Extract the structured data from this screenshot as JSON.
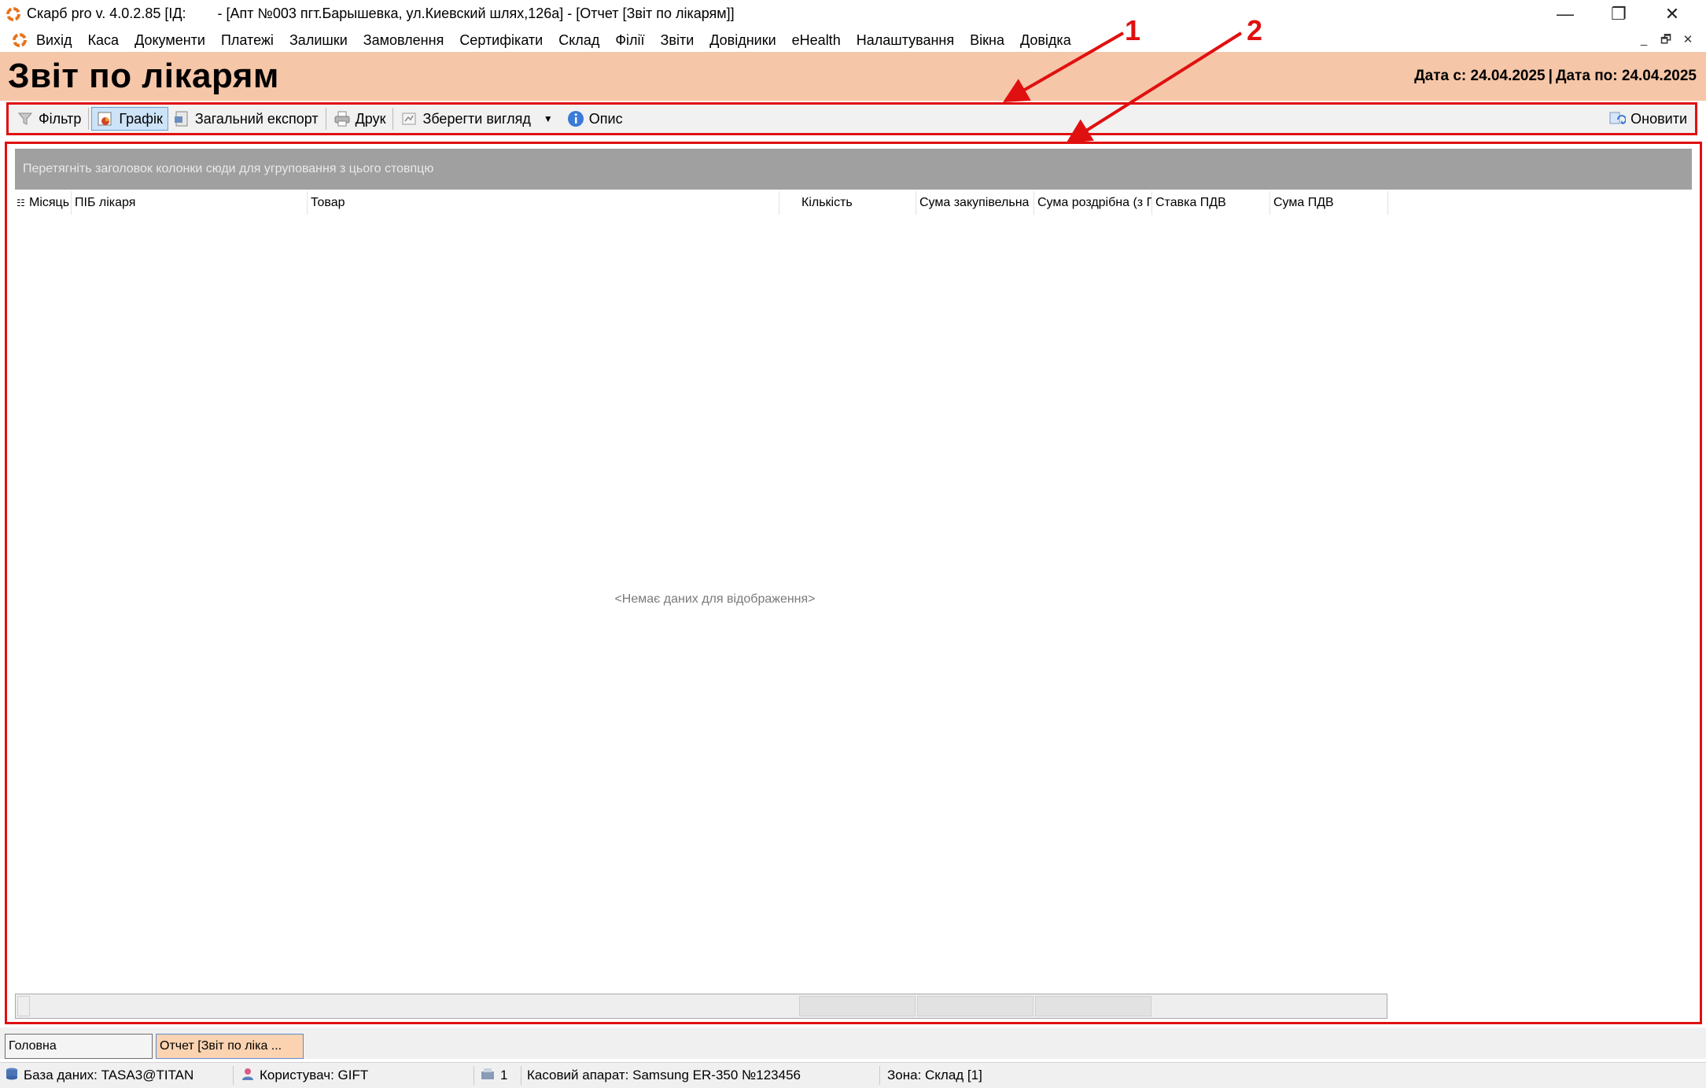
{
  "window": {
    "title": "Скарб pro v. 4.0.2.85 [ІД:        - [Апт №003 пгт.Барышевка, ул.Киевский шлях,126а] - [Отчет [Звіт по лікарям]]",
    "minimize": "—",
    "restore": "❐",
    "close": "✕"
  },
  "menu": {
    "items": [
      "Вихід",
      "Каса",
      "Документи",
      "Платежі",
      "Залишки",
      "Замовлення",
      "Сертифікати",
      "Склад",
      "Філії",
      "Звіти",
      "Довідники",
      "eHealth",
      "Налаштування",
      "Вікна",
      "Довідка"
    ],
    "mdi_minimize": "_",
    "mdi_restore": "🗗",
    "mdi_close": "✕"
  },
  "header": {
    "title": "Звіт по лікарям",
    "date_from": "Дата с: 24.04.2025",
    "separator": "|",
    "date_to": "Дата по: 24.04.2025"
  },
  "toolbar": {
    "filter": "Фільтр",
    "chart": "Графік",
    "export": "Загальний експорт",
    "print": "Друк",
    "save_view": "Зберегти вигляд",
    "description": "Опис",
    "refresh": "Оновити"
  },
  "grid": {
    "group_hint": "Перетягніть заголовок колонки сюди для угруповання з цього стовпцю",
    "columns": [
      "Місяць",
      "ПІБ лікаря",
      "Товар",
      "Кількість",
      "Сума закупівельна",
      "Сума роздрібна (з П",
      "Ставка ПДВ",
      "Сума ПДВ"
    ],
    "empty_message": "<Немає даних для відображення>"
  },
  "annotations": {
    "label_1": "1",
    "label_2": "2"
  },
  "tabs": [
    "Головна",
    "Отчет [Звіт по ліка ..."
  ],
  "status": {
    "database": "База даних: TASA3@TITAN",
    "user": "Користувач: GIFT",
    "queue": "1",
    "cash_register": "Касовий апарат: Samsung ER-350 №123456",
    "zone": "Зона: Склад [1]"
  },
  "colors": {
    "accent_red": "#e01010",
    "header_band": "#f6c6a8",
    "active_tab": "#fbd3b0"
  }
}
